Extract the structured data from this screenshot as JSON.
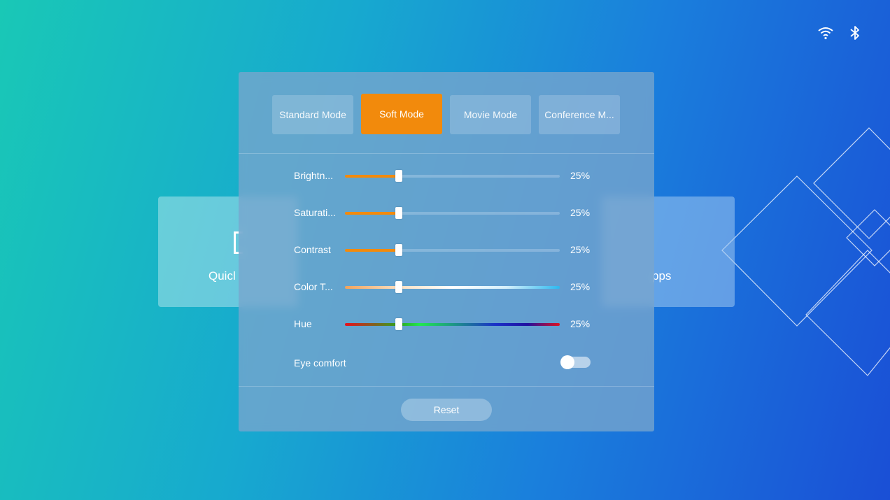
{
  "status_bar": {
    "icons": [
      "wifi-icon",
      "bluetooth-icon"
    ]
  },
  "background_cards": {
    "left_label": "Quicl",
    "right_label": "pps"
  },
  "modes": {
    "items": [
      {
        "label": "Standard Mode",
        "active": false
      },
      {
        "label": "Soft Mode",
        "active": true
      },
      {
        "label": "Movie Mode",
        "active": false
      },
      {
        "label": "Conference M..."
      }
    ],
    "active_color": "#f28a0c"
  },
  "settings": {
    "brightness": {
      "label": "Brightn...",
      "value": "25%",
      "level": 0.25
    },
    "saturation": {
      "label": "Saturati...",
      "value": "25%",
      "level": 0.25
    },
    "contrast": {
      "label": "Contrast",
      "value": "25%",
      "level": 0.25
    },
    "color_temp": {
      "label": "Color T...",
      "value": "25%",
      "level": 0.25
    },
    "hue": {
      "label": "Hue",
      "value": "25%",
      "level": 0.25
    },
    "eye_comfort": {
      "label": "Eye comfort",
      "on": false
    }
  },
  "reset_label": "Reset"
}
